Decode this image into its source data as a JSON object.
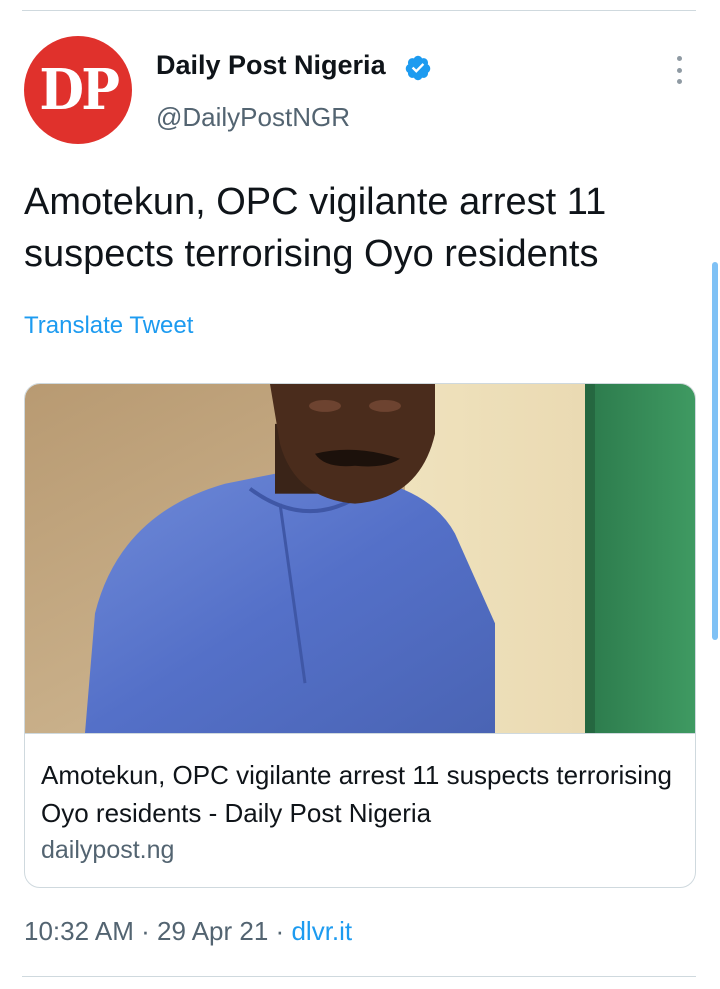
{
  "author": {
    "avatar_text": "DP",
    "name": "Daily Post Nigeria",
    "handle": "@DailyPostNGR",
    "verified": true
  },
  "tweet": {
    "text": "Amotekun, OPC vigilante arrest 11 suspects terrorising Oyo residents",
    "translate_label": "Translate Tweet"
  },
  "card": {
    "image_alt": "Photo of a man in a blue kaftan",
    "title": "Amotekun, OPC vigilante arrest 11 suspects terrorising Oyo residents - Daily Post Nigeria",
    "domain": "dailypost.ng"
  },
  "meta": {
    "time": "10:32 AM",
    "separator": "·",
    "date": "29 Apr 21",
    "source": "dlvr.it"
  },
  "colors": {
    "avatar_bg": "#e0312c",
    "link": "#1d9bf0",
    "secondary_text": "#536471",
    "verified": "#1d9bf0"
  },
  "icons": {
    "verified": "verified-badge-icon",
    "more": "more-vertical-icon"
  }
}
